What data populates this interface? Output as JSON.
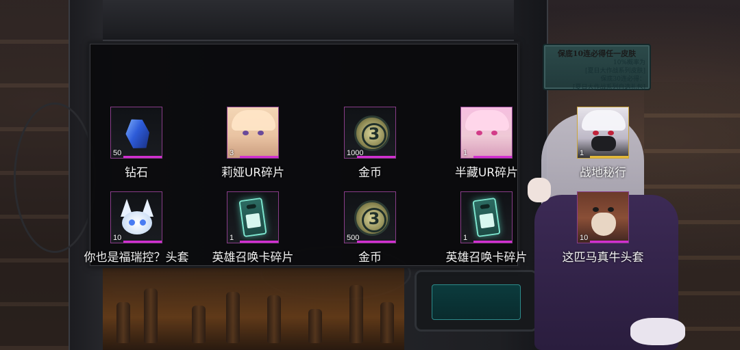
{
  "promo": {
    "line1": "保底10连必得任一皮肤",
    "line2": "10%概率为",
    "line3": "[夏日大作战系列皮肤]",
    "line4": "保底30连必得：",
    "line5": "[夏日大作战系列自选礼包]"
  },
  "rewards": [
    {
      "name": "钻石",
      "count": "50",
      "icon": "diamond-gem-icon"
    },
    {
      "name": "莉娅UR碎片",
      "count": "3",
      "icon": "character-portrait-icon"
    },
    {
      "name": "金币",
      "count": "1000",
      "icon": "coin-icon",
      "glyph": "3"
    },
    {
      "name": "半藏UR碎片",
      "count": "1",
      "icon": "character-portrait-icon"
    },
    {
      "name": "战地秘行",
      "count": "1",
      "icon": "character-portrait-icon"
    },
    {
      "name": "你也是福瑞控？头套",
      "count": "10",
      "icon": "fox-mask-icon"
    },
    {
      "name": "英雄召唤卡碎片",
      "count": "1",
      "icon": "summon-card-icon"
    },
    {
      "name": "金币",
      "count": "500",
      "icon": "coin-icon",
      "glyph": "3"
    },
    {
      "name": "英雄召唤卡碎片",
      "count": "1",
      "icon": "summon-card-icon"
    },
    {
      "name": "这匹马真牛头套",
      "count": "10",
      "icon": "horse-mask-icon"
    }
  ],
  "colors": {
    "rare_border": "#8a3d8a",
    "rare_bar": "#d12fd1",
    "legend_border": "#c9a43a",
    "legend_bar": "#e4b93a"
  }
}
